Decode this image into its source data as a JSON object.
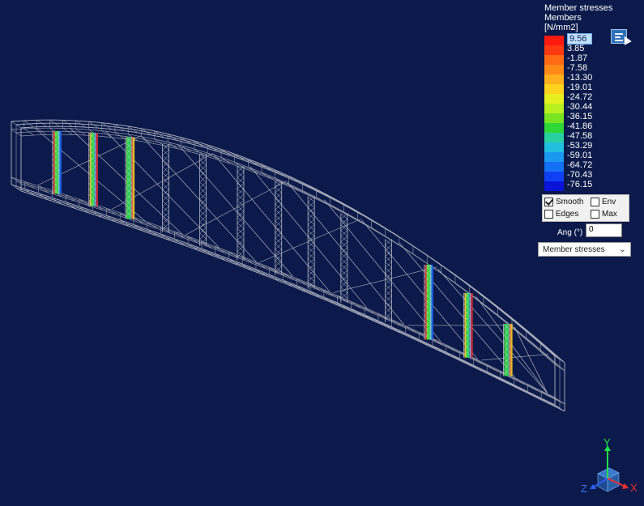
{
  "legend": {
    "title": "Member stresses",
    "subtitle": "Members",
    "unit": "[N/mm2]",
    "values": [
      "9.56",
      "3.85",
      "-1.87",
      "-7.58",
      "-13.30",
      "-19.01",
      "-24.72",
      "-30.44",
      "-36.15",
      "-41.86",
      "-47.58",
      "-53.29",
      "-59.01",
      "-64.72",
      "-70.43",
      "-76.15"
    ],
    "colors": [
      "#ff1a10",
      "#ff3a10",
      "#ff6a12",
      "#ff8a18",
      "#ffb01c",
      "#ffd21c",
      "#e6f020",
      "#b8f020",
      "#78e422",
      "#2fd838",
      "#28d0a0",
      "#22c0e0",
      "#1a98f0",
      "#1470f4",
      "#1040f4",
      "#0a14d8"
    ]
  },
  "options": {
    "smooth_label": "Smooth",
    "smooth_checked": true,
    "env_label": "Env",
    "env_checked": false,
    "edges_label": "Edges",
    "edges_checked": false,
    "max_label": "Max",
    "max_checked": false
  },
  "angle": {
    "label": "Ang (°)",
    "value": "0"
  },
  "result_select": {
    "selected": "Member stresses"
  },
  "axes": {
    "x": "X",
    "y": "Y",
    "z": "Z"
  },
  "icons": {
    "options_button": "options-icon",
    "dropdown": "chevron-down-icon"
  }
}
